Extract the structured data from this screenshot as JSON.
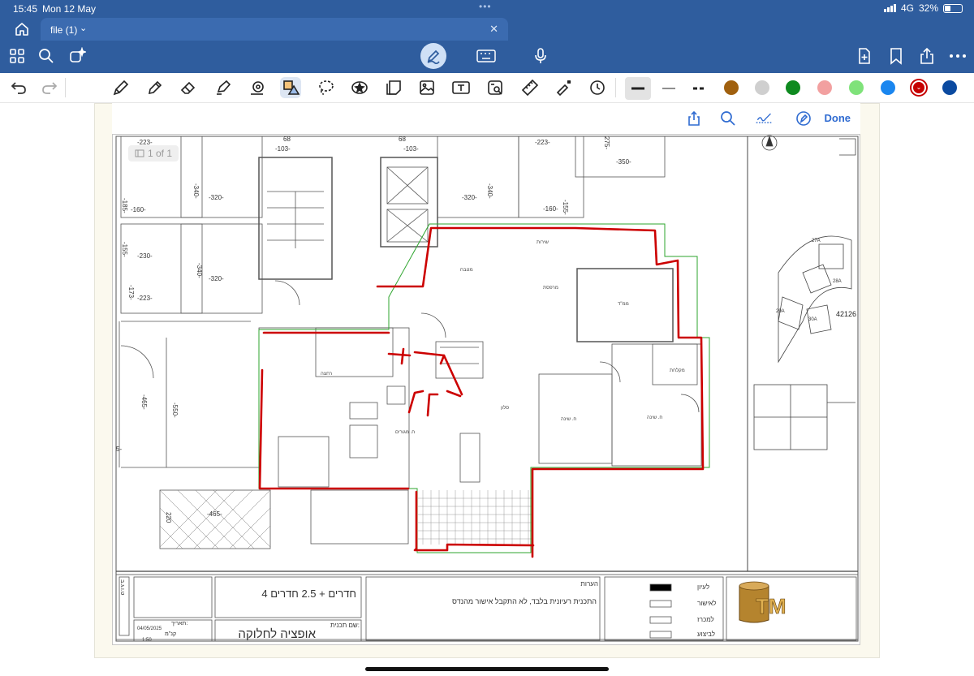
{
  "status_bar": {
    "time": "15:45",
    "date": "Mon 12 May",
    "network": "4G",
    "battery": "32%"
  },
  "tab": {
    "name": "file (1)"
  },
  "app_toolbar": {
    "icons": [
      "home-icon",
      "grid-icon",
      "search-icon",
      "magic-icon",
      "pen-markup-icon",
      "keyboard-icon",
      "microphone-icon",
      "add-page-icon",
      "bookmark-icon",
      "share-icon",
      "more-icon"
    ]
  },
  "markup_tools": {
    "tools": [
      "undo-icon",
      "redo-icon",
      "pen-icon",
      "pencil-icon",
      "eraser-icon",
      "highlighter-icon",
      "stamp-icon",
      "shape-tool-icon",
      "lasso-icon",
      "sticker-icon",
      "sticky-note-icon",
      "image-icon",
      "text-box-icon",
      "scan-icon",
      "ruler-icon",
      "laser-pointer-icon",
      "clock-icon"
    ],
    "colors": [
      "#a0600e",
      "#cfcfcf",
      "#0e8a1f",
      "#f2a0a0",
      "#7fe27a",
      "#1a86ef",
      "#c60000",
      "#0b4aa0"
    ],
    "selected_color": "#c60000"
  },
  "doc_toolbar": {
    "done_label": "Done"
  },
  "page_indicator": "1 of 1",
  "plan": {
    "dimensions": [
      "-223-",
      "-103-",
      "68",
      "-340-",
      "-320-",
      "-160-",
      "-185-",
      "-155-",
      "-230-",
      "-173-",
      "-223-",
      "-340-",
      "-320-",
      "68",
      "-103-",
      "-320-",
      "-340-",
      "-223-",
      "-160-",
      "-155-",
      "275-",
      "-350-",
      "-465-",
      "-550-",
      "-465-",
      "220",
      "42126",
      "27A",
      "29A",
      "28A",
      "30A",
      "5-"
    ],
    "room_labels": [
      "ח. שינה",
      "ח. שינה",
      "סלון",
      "ח. מגורים",
      "מטבח",
      "ממ\"ד",
      "רחצה",
      "מרפסת",
      "שירות",
      "מקלחת"
    ],
    "legend_title": "הערות",
    "legend_note": "התכנית רעיונית בלבד, לא התקבל אישור מהנדס",
    "title_rooms": "4 חדרים + 2.5 חדרים",
    "plan_name_label": "שם תכנית:",
    "plan_name": "אופציה לחלוקה",
    "date_label": "תאריך:",
    "date_value": "04/05/2025",
    "scale_label": "קנ\"מ",
    "scale_value": "1:50",
    "stage_labels": [
      "לעיון",
      "לאישור",
      "למכרז",
      "לביצוע"
    ],
    "side_label": "ט.ו.ג.ב",
    "logo_text": "TM"
  }
}
